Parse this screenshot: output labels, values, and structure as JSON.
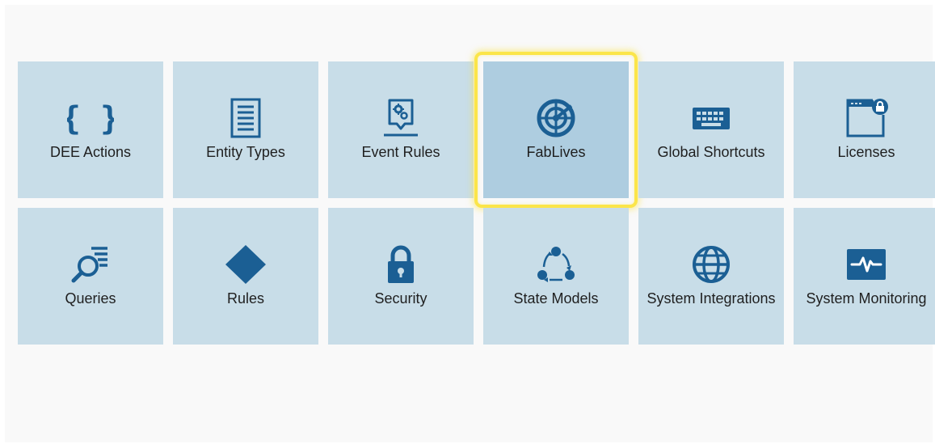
{
  "colors": {
    "tile_background": "#c8dde8",
    "tile_selected_background": "#aecde0",
    "selection_highlight": "#fbe54a",
    "icon_color": "#1b5f94"
  },
  "tiles": [
    {
      "label": "DEE Actions",
      "icon": "curly-braces-icon",
      "selected": false
    },
    {
      "label": "Entity Types",
      "icon": "document-list-icon",
      "selected": false
    },
    {
      "label": "Event Rules",
      "icon": "gear-badge-icon",
      "selected": false
    },
    {
      "label": "FabLives",
      "icon": "radar-icon",
      "selected": true
    },
    {
      "label": "Global Shortcuts",
      "icon": "keyboard-icon",
      "selected": false
    },
    {
      "label": "Licenses",
      "icon": "locked-window-icon",
      "selected": false
    },
    {
      "label": "Queries",
      "icon": "search-list-icon",
      "selected": false
    },
    {
      "label": "Rules",
      "icon": "diamond-icon",
      "selected": false
    },
    {
      "label": "Security",
      "icon": "padlock-icon",
      "selected": false
    },
    {
      "label": "State Models",
      "icon": "cycle-icon",
      "selected": false
    },
    {
      "label": "System Integrations",
      "icon": "globe-icon",
      "selected": false
    },
    {
      "label": "System Monitoring",
      "icon": "heartbeat-monitor-icon",
      "selected": false
    }
  ]
}
